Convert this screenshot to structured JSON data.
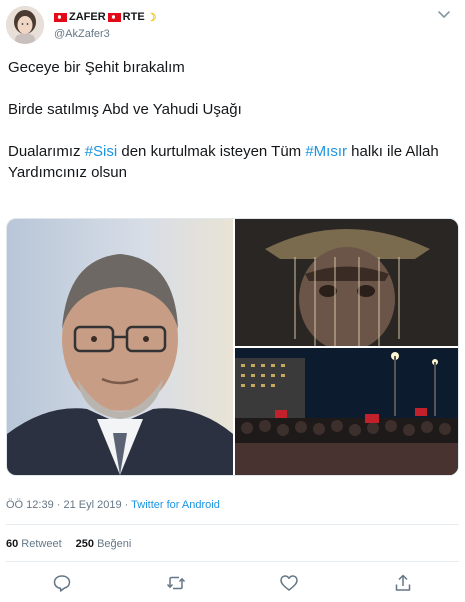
{
  "user": {
    "display_name": "ZAFER",
    "display_suffix": "RTE",
    "handle": "@AkZafer3"
  },
  "tweet": {
    "line1": "Geceye bir Şehit bırakalım",
    "line2": "Birde satılmış Abd ve Yahudi  Uşağı",
    "line3_a": "Dualarımız ",
    "hashtag1": "#Sisi",
    "line3_b": " den kurtulmak isteyen Tüm ",
    "hashtag2": "#Mısır",
    "line3_c": " halkı ile Allah Yardımcınız olsun"
  },
  "meta": {
    "time": "ÖÖ 12:39",
    "separator": " · ",
    "date": "21 Eyl 2019",
    "source": "Twitter for Android"
  },
  "stats": {
    "retweets_count": "60",
    "retweets_label": " Retweet",
    "likes_count": "250",
    "likes_label": " Beğeni"
  },
  "icons": {
    "more": "chevron-down-icon",
    "reply": "reply-icon",
    "retweet": "retweet-icon",
    "like": "heart-icon",
    "share": "share-icon"
  },
  "colors": {
    "link": "#1b95e0",
    "muted": "#657786",
    "text": "#14171a"
  }
}
